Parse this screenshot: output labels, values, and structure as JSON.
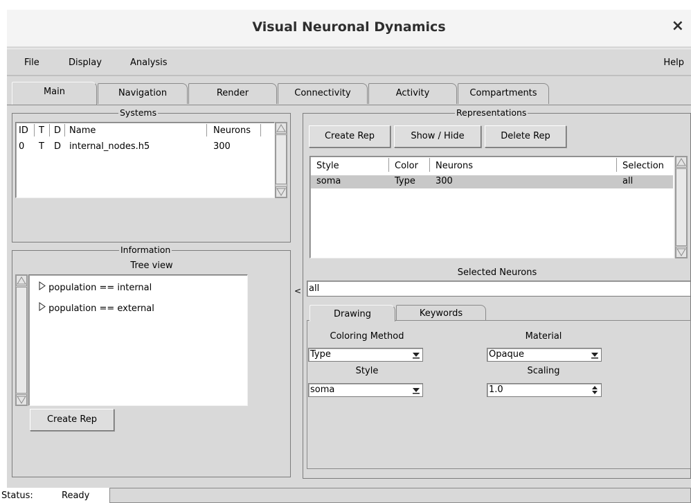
{
  "window": {
    "title": "Visual Neuronal Dynamics",
    "close_glyph": "×"
  },
  "menubar": {
    "file": "File",
    "display": "Display",
    "analysis": "Analysis",
    "help": "Help"
  },
  "tabs": [
    {
      "label": "Main",
      "active": true
    },
    {
      "label": "Navigation",
      "active": false
    },
    {
      "label": "Render",
      "active": false
    },
    {
      "label": "Connectivity",
      "active": false
    },
    {
      "label": "Activity",
      "active": false
    },
    {
      "label": "Compartments",
      "active": false
    }
  ],
  "systems": {
    "title": "Systems",
    "headers": {
      "id": "ID",
      "t": "T",
      "d": "D",
      "name": "Name",
      "neurons": "Neurons"
    },
    "rows": [
      {
        "id": "0",
        "t": "T",
        "d": "D",
        "name": "internal_nodes.h5",
        "neurons": "300"
      }
    ]
  },
  "information": {
    "title": "Information",
    "subtitle": "Tree view",
    "tree": [
      "population == internal",
      "population == external"
    ],
    "create_rep_button": "Create Rep"
  },
  "collapse_arrow": "<",
  "representations": {
    "title": "Representations",
    "buttons": {
      "create": "Create Rep",
      "show_hide": "Show / Hide",
      "delete": "Delete Rep"
    },
    "headers": {
      "style": "Style",
      "color": "Color",
      "neurons": "Neurons",
      "selection": "Selection"
    },
    "rows": [
      {
        "style": "soma",
        "color": "Type",
        "neurons": "300",
        "selection": "all"
      }
    ],
    "selected_neurons_label": "Selected Neurons",
    "selected_neurons_value": "all"
  },
  "subtabs": [
    {
      "label": "Drawing",
      "active": true
    },
    {
      "label": "Keywords",
      "active": false
    }
  ],
  "drawing": {
    "coloring_method_label": "Coloring Method",
    "coloring_method_value": "Type",
    "material_label": "Material",
    "material_value": "Opaque",
    "style_label": "Style",
    "style_value": "soma",
    "scaling_label": "Scaling",
    "scaling_value": "1.0"
  },
  "status": {
    "label": "Status:",
    "value": "Ready"
  },
  "colors": {
    "window_bg": "#d9d9d9",
    "selected_row": "#c8c8c8",
    "title_bg": "#f4f4f4"
  }
}
